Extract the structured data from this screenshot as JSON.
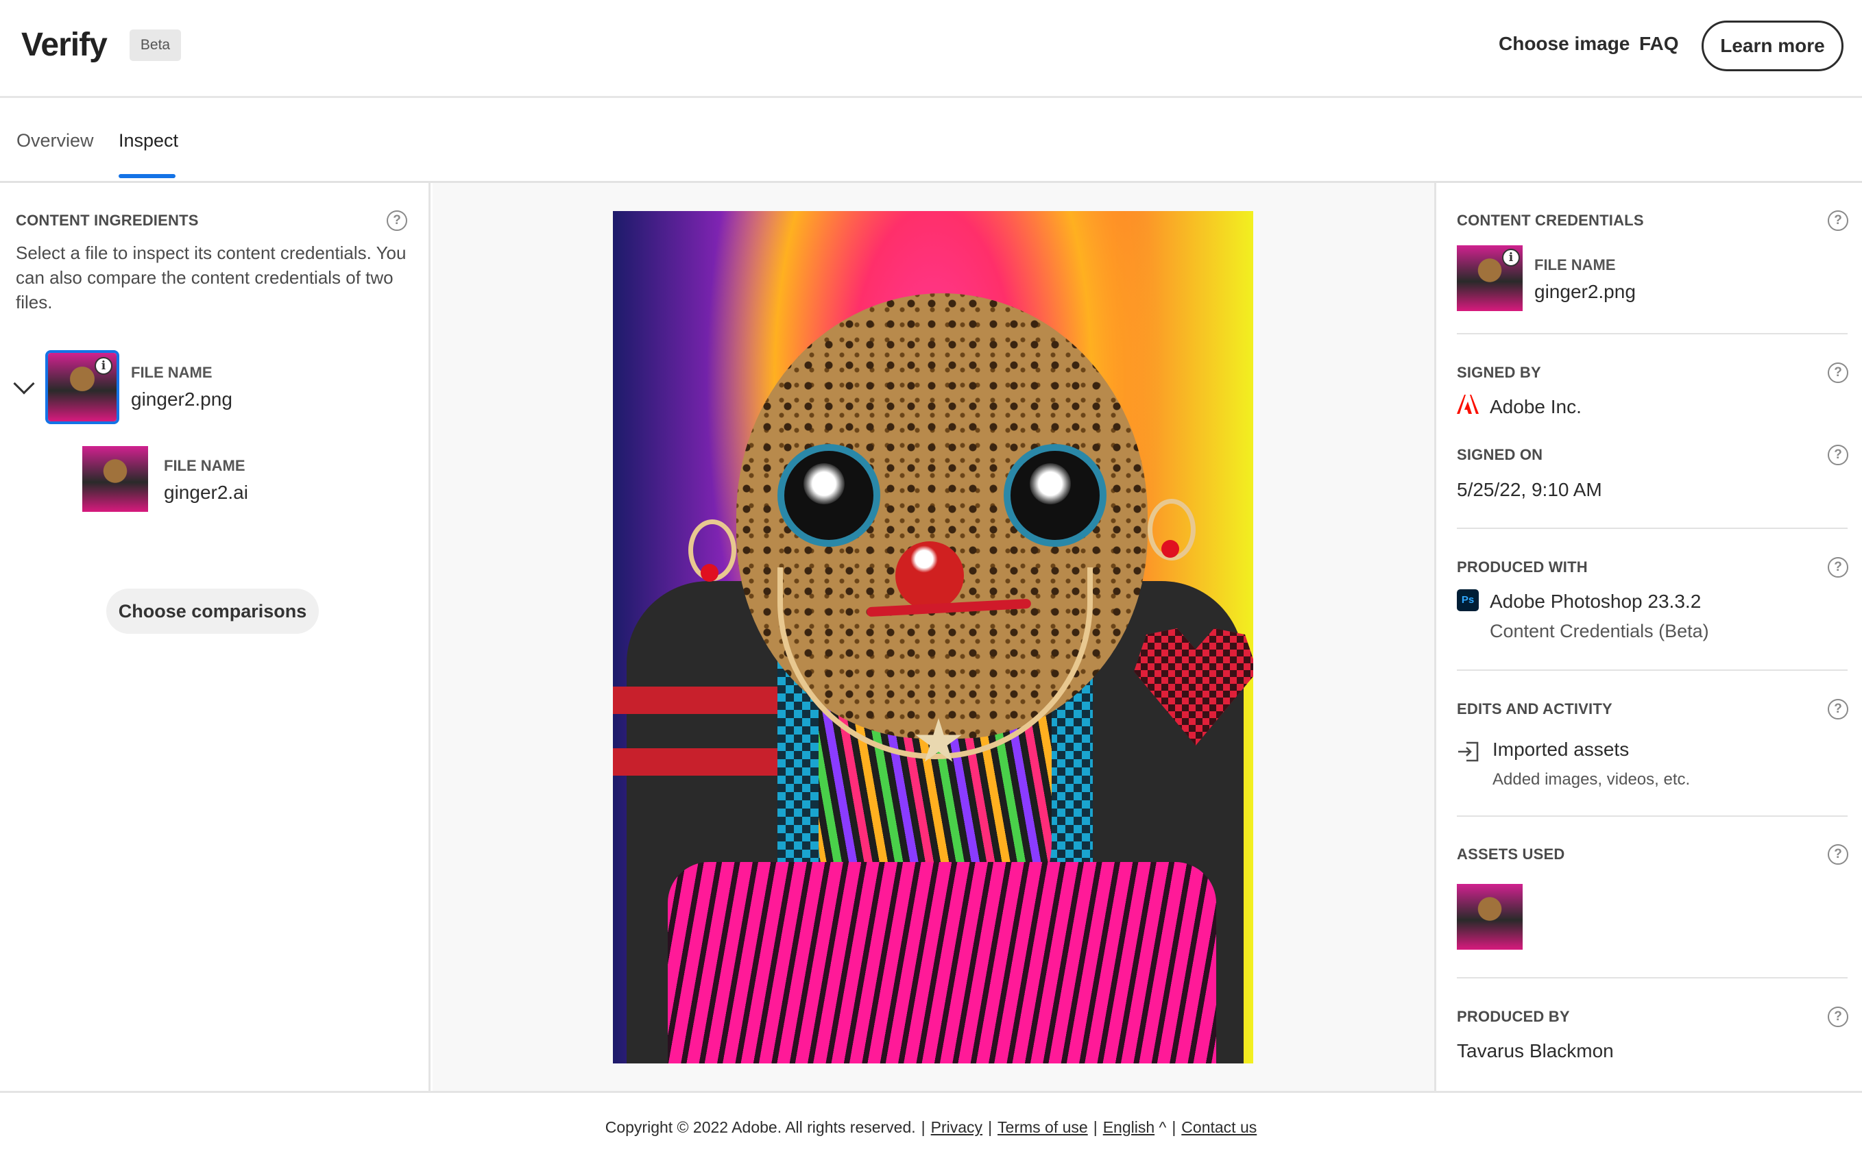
{
  "header": {
    "logo": "Verify",
    "badge": "Beta",
    "nav": [
      {
        "label": "Choose image"
      },
      {
        "label": "FAQ"
      }
    ],
    "cta": "Learn more"
  },
  "tabs": [
    {
      "label": "Overview",
      "active": false
    },
    {
      "label": "Inspect",
      "active": true
    }
  ],
  "left_panel": {
    "title": "CONTENT INGREDIENTS",
    "description": "Select a file to inspect its content credentials. You can also compare the content credentials of two files.",
    "files": [
      {
        "label": "FILE NAME",
        "name": "ginger2.png",
        "selected": true
      },
      {
        "label": "FILE NAME",
        "name": "ginger2.ai",
        "selected": false
      }
    ],
    "compare_button": "Choose comparisons"
  },
  "right_panel": {
    "title": "CONTENT CREDENTIALS",
    "file": {
      "label": "FILE NAME",
      "name": "ginger2.png"
    },
    "signed_by": {
      "label": "SIGNED BY",
      "value": "Adobe Inc."
    },
    "signed_on": {
      "label": "SIGNED ON",
      "value": "5/25/22, 9:10 AM"
    },
    "produced_with": {
      "label": "PRODUCED WITH",
      "app": "Adobe Photoshop 23.3.2",
      "sub": "Content Credentials (Beta)",
      "icon_text": "Ps"
    },
    "edits": {
      "label": "EDITS AND ACTIVITY",
      "title": "Imported assets",
      "sub": "Added images, videos, etc."
    },
    "assets": {
      "label": "ASSETS USED"
    },
    "produced_by": {
      "label": "PRODUCED BY",
      "value": "Tavarus Blackmon"
    }
  },
  "footer": {
    "copyright": "Copyright © 2022 Adobe. All rights reserved.",
    "links": [
      "Privacy",
      "Terms of use",
      "English",
      "Contact us"
    ],
    "caret": "^"
  },
  "icons": {
    "help": "?",
    "info": "i"
  },
  "colors": {
    "accent": "#1473e6",
    "adobe_red": "#fa0f00",
    "ps_bg": "#001e36",
    "ps_text": "#31a8ff"
  }
}
